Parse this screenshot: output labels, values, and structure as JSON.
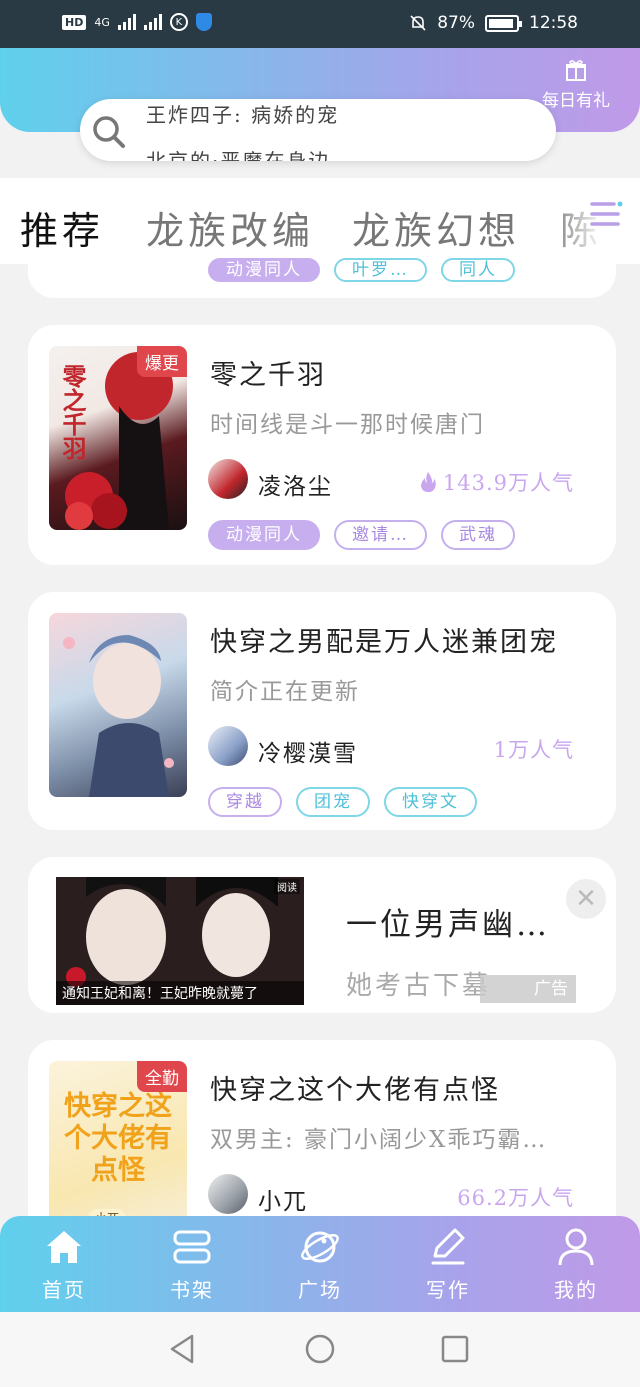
{
  "status_bar": {
    "network": "HD",
    "network_type": "4G",
    "k_icon": "K",
    "battery": "87%",
    "time": "12:58"
  },
  "header": {
    "gift_label": "每日有礼",
    "search_line1": "王炸四子: 病娇的宠",
    "search_line2": "北京的·恶魔在身边"
  },
  "tabs": [
    {
      "label": "推荐",
      "active": true
    },
    {
      "label": "龙族改编",
      "active": false
    },
    {
      "label": "龙族幻想",
      "active": false
    },
    {
      "label": "陈情",
      "active": false
    }
  ],
  "partial_card": {
    "tags": [
      "动漫同人",
      "叶罗…",
      "同人"
    ]
  },
  "books": [
    {
      "title": "零之千羽",
      "description": "时间线是斗一那时候唐门",
      "author": "凌洛尘",
      "popularity": "143.9万人气",
      "badge": "爆更",
      "tags": [
        "动漫同人",
        "邀请…",
        "武魂"
      ],
      "cover_text": "零之千羽"
    },
    {
      "title": "快穿之男配是万人迷兼团宠",
      "description": "简介正在更新",
      "author": "冷樱漠雪",
      "popularity": "1万人气",
      "badge": "",
      "tags": [
        "穿越",
        "团宠",
        "快穿文"
      ]
    },
    {
      "title": "快穿之这个大佬有点怪",
      "description": "双男主: 豪门小阔少X乖巧霸…",
      "author": "小兀",
      "popularity": "66.2万人气",
      "badge": "全勤",
      "cover_text": "快穿之这个大佬有点怪",
      "cover_author": "小兀"
    }
  ],
  "ad": {
    "title": "一位男声幽…",
    "description": "她考古下墓",
    "label": "广告",
    "image_caption": "通知王妃和离！王妃昨晚就薨了",
    "image_tag": "阅读"
  },
  "bottom_nav": [
    {
      "label": "首页",
      "icon": "home-icon"
    },
    {
      "label": "书架",
      "icon": "bookshelf-icon"
    },
    {
      "label": "广场",
      "icon": "planet-icon"
    },
    {
      "label": "写作",
      "icon": "pen-icon"
    },
    {
      "label": "我的",
      "icon": "user-icon"
    }
  ],
  "colors": {
    "gradient_start": "#5fd0ec",
    "gradient_end": "#c09ae8",
    "accent_purple": "#c7afef",
    "accent_cyan": "#4fc0d8",
    "badge_red": "#e0474d"
  }
}
